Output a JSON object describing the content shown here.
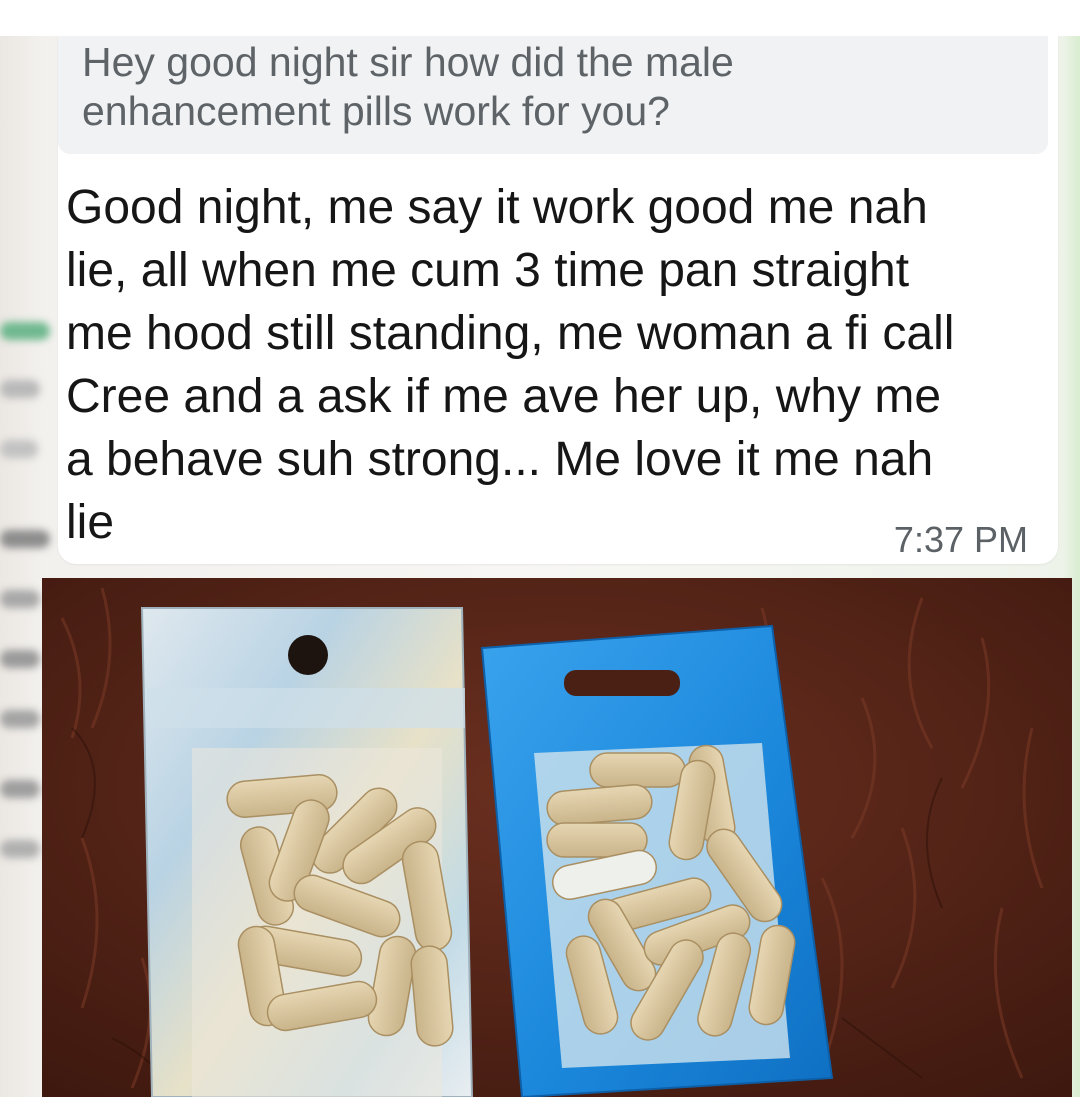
{
  "chat": {
    "quoted_message": "Hey good night sir how did the male enhancement pills work for you?",
    "reply_message": "Good night, me say it work good me nah\nlie, all when me cum 3 time pan straight\nme hood still standing, me woman a fi call\nCree and a ask if me ave her up, why me\na behave suh strong...   Me love it me nah\nlie",
    "timestamp": "7:37 PM"
  },
  "photo": {
    "subject": "two resealable pouches of beige capsules on a brown furry rug",
    "colors": {
      "rug": "#5a2718",
      "silver_pouch": "#c9d6dc",
      "blue_pouch": "#1f8fe0",
      "capsule": "#d9c7a0"
    }
  }
}
